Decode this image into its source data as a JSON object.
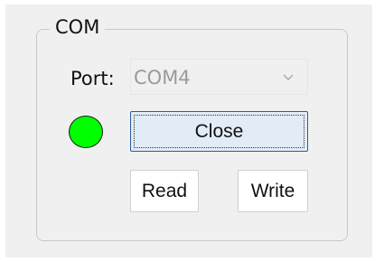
{
  "com_group": {
    "title": "COM",
    "port_label": "Port:",
    "port_value": "COM4",
    "close_label": "Close",
    "read_label": "Read",
    "write_label": "Write"
  },
  "icons": {
    "combo_arrow": "chevron-down-icon",
    "status": "status-indicator-icon"
  },
  "colors": {
    "status_led": "#00ff00",
    "close_button_bg": "#e1ecf7",
    "close_button_border": "#2b5e9c"
  }
}
